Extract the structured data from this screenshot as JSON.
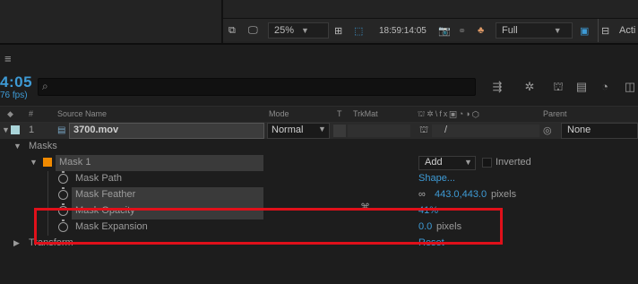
{
  "viewer": {
    "zoom": "25%",
    "timecode": "18:59:14:05",
    "resolution": "Full",
    "active_label": "Acti"
  },
  "timeline": {
    "timecode": "4:05",
    "fps": "76 fps)",
    "search_placeholder": ""
  },
  "columns": {
    "hash": "#",
    "source_name": "Source Name",
    "mode": "Mode",
    "t": "T",
    "trkmat": "TrkMat",
    "parent": "Parent"
  },
  "layer": {
    "number": "1",
    "name": "3700.mov",
    "mode": "Normal",
    "parent": "None"
  },
  "masks": {
    "group_label": "Masks",
    "mask_name": "Mask 1",
    "mode": "Add",
    "inverted_label": "Inverted",
    "properties": [
      {
        "name": "Mask Path",
        "value": "Shape...",
        "unit": ""
      },
      {
        "name": "Mask Feather",
        "value": "443.0,443.0",
        "unit": "pixels"
      },
      {
        "name": "Mask Opacity",
        "value": "41%",
        "unit": ""
      },
      {
        "name": "Mask Expansion",
        "value": "0.0",
        "unit": "pixels"
      }
    ]
  },
  "transform": {
    "label": "Transform",
    "value": "Reset"
  },
  "colors": {
    "accent_blue": "#3e9bd6",
    "highlight_red": "#e0101a",
    "mask_color": "#f08a00",
    "layer_color": "#a9d4d9"
  }
}
